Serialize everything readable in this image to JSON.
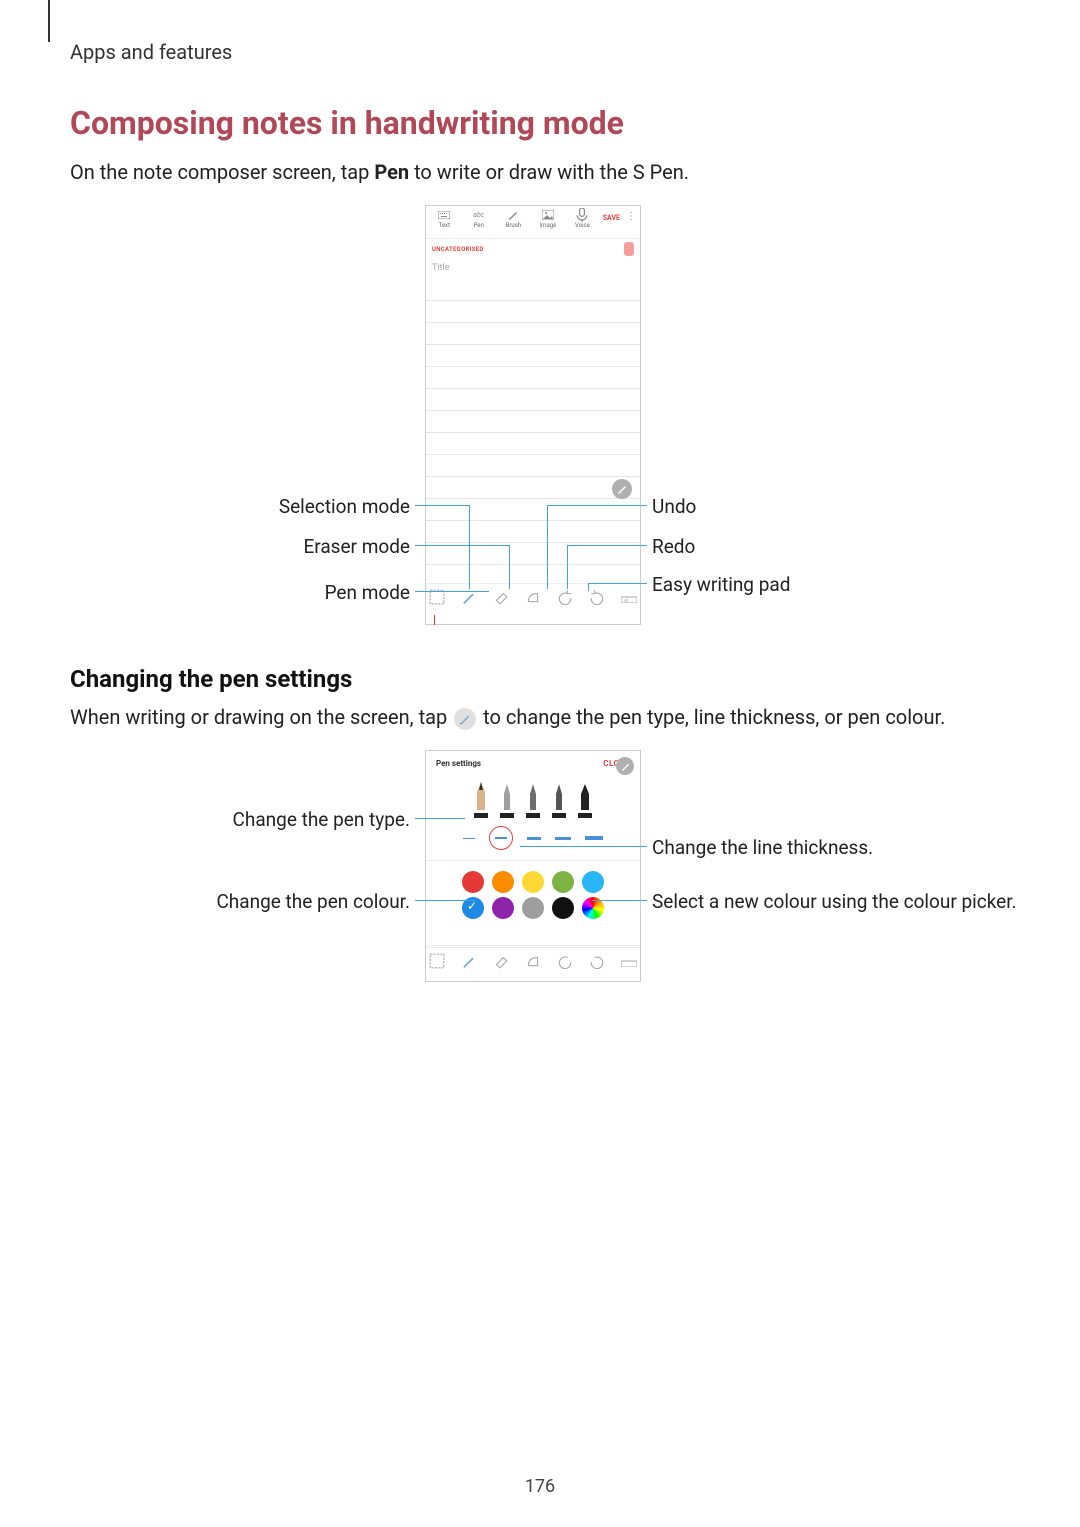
{
  "breadcrumb": "Apps and features",
  "heading": "Composing notes in handwriting mode",
  "intro_before": "On the note composer screen, tap ",
  "intro_bold": "Pen",
  "intro_after": " to write or draw with the S Pen.",
  "phone1": {
    "toolbar": {
      "text": "Text",
      "pen": "Pen",
      "brush": "Brush",
      "image": "Image",
      "voice": "Voice",
      "save": "SAVE"
    },
    "category": "UNCATEGORISED",
    "title_placeholder": "Title"
  },
  "callouts1": {
    "selection": "Selection mode",
    "eraser": "Eraser mode",
    "pen": "Pen mode",
    "undo": "Undo",
    "redo": "Redo",
    "ewp": "Easy writing pad"
  },
  "subheading": "Changing the pen settings",
  "para2_before": "When writing or drawing on the screen, tap ",
  "para2_after": " to change the pen type, line thickness, or pen colour.",
  "phone2": {
    "title": "Pen settings",
    "close": "CLOSE",
    "colours_row1": [
      "#e53935",
      "#fb8c00",
      "#fdd835",
      "#7cb342",
      "#29b6f6"
    ],
    "colours_row2": [
      "#1e88e5",
      "#8e24aa",
      "#9e9e9e",
      "#111111"
    ]
  },
  "callouts2": {
    "pentype": "Change the pen type.",
    "pencolour": "Change the pen colour.",
    "thickness": "Change the line thickness.",
    "picker": "Select a new colour using the colour picker."
  },
  "page_number": "176"
}
